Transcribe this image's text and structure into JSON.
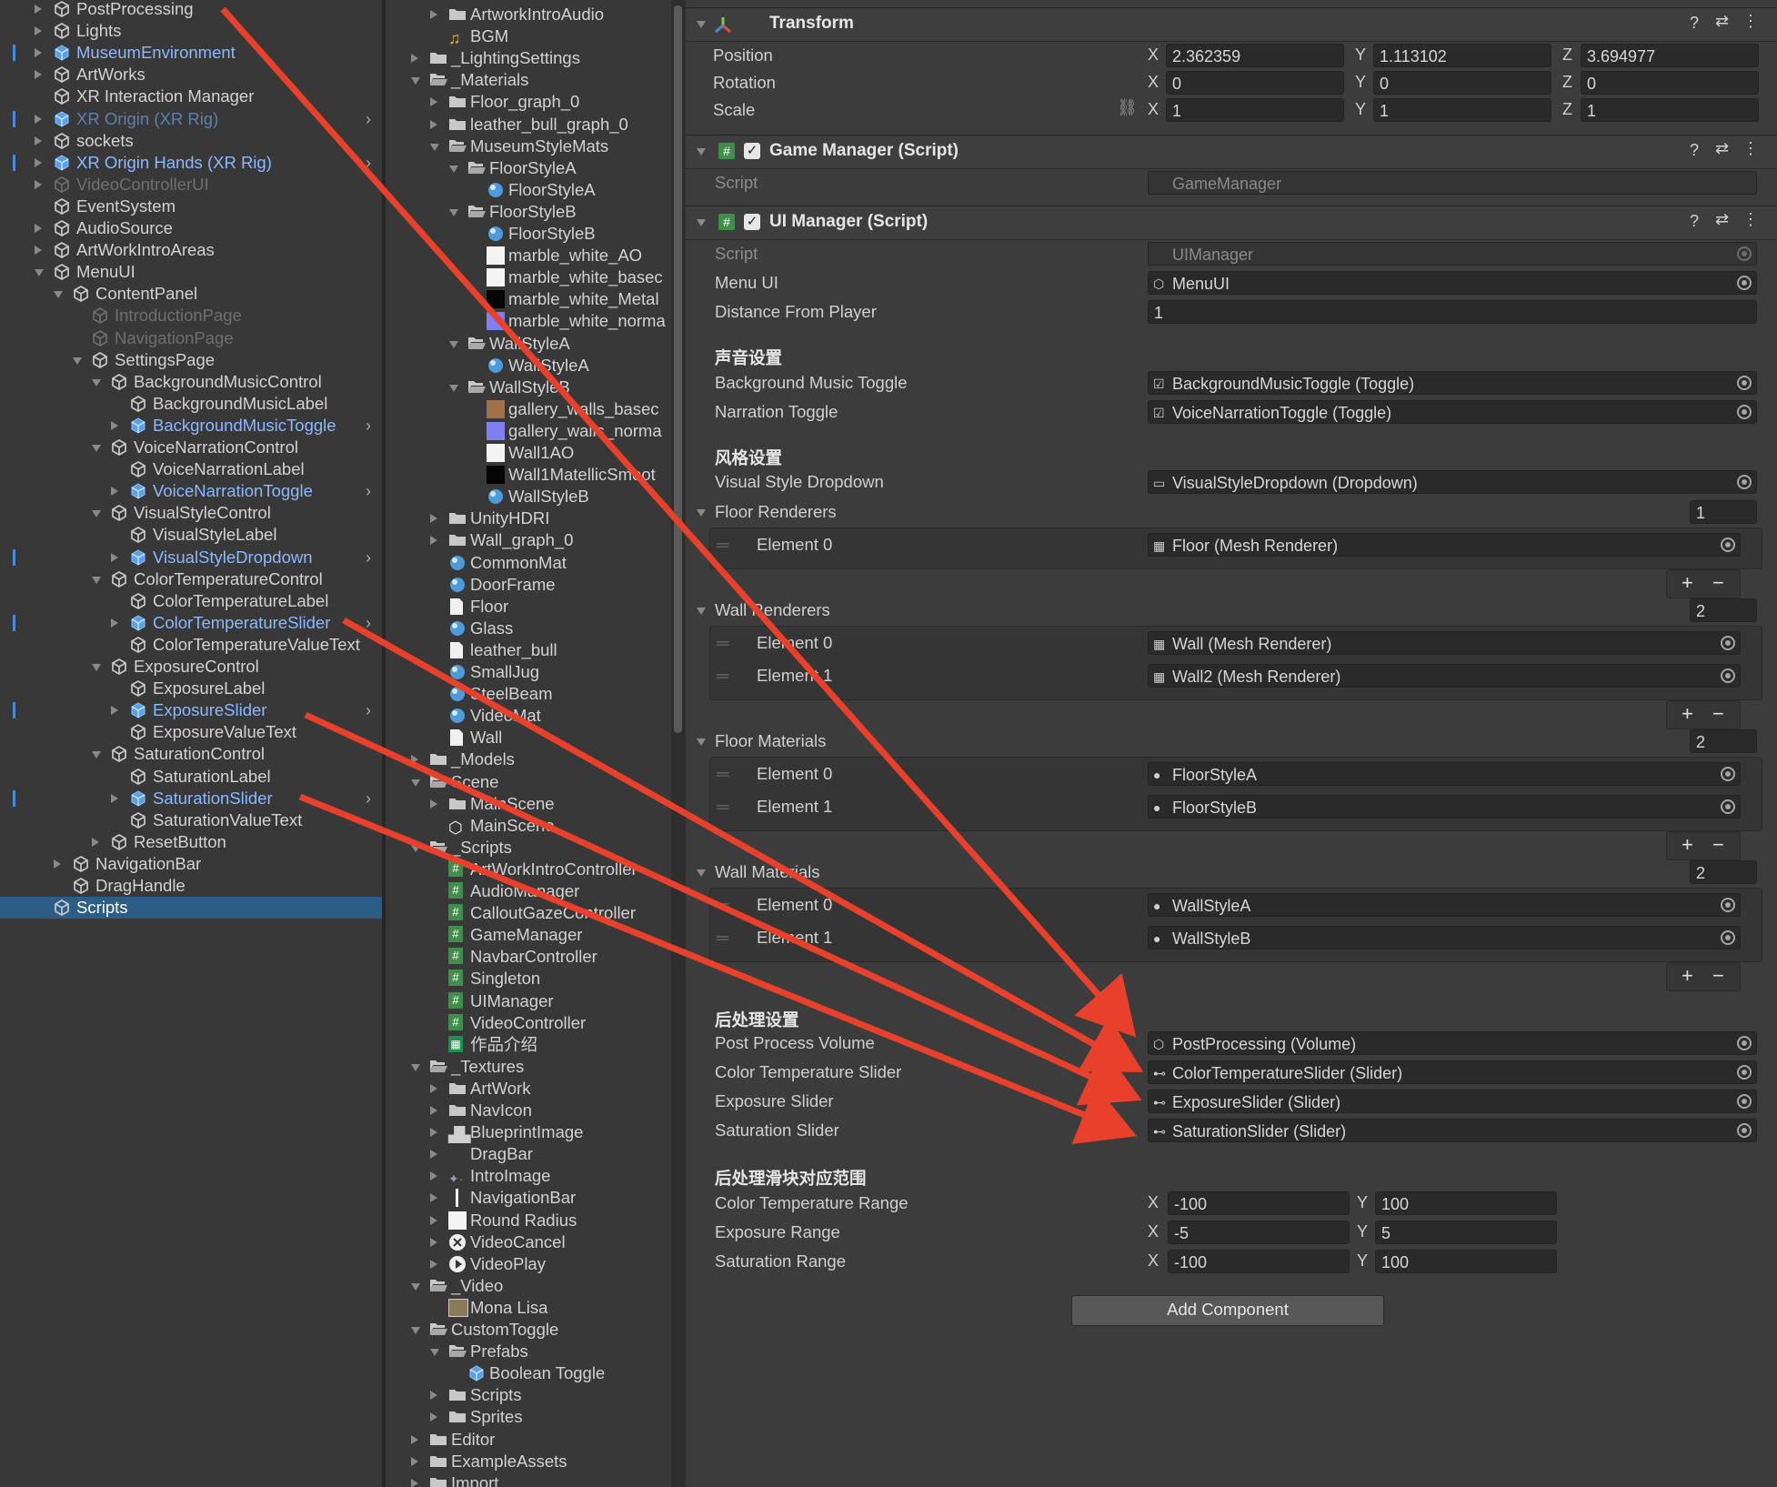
{
  "hierarchy": {
    "items": [
      {
        "label": "PostProcessing",
        "style": "normal",
        "indent": 0,
        "tri": "c",
        "icon": "cube-outline"
      },
      {
        "label": "Lights",
        "style": "normal",
        "indent": 0,
        "tri": "c",
        "icon": "cube-outline"
      },
      {
        "label": "MuseumEnvironment",
        "style": "blue",
        "indent": 0,
        "tri": "c",
        "icon": "prefab",
        "bar": true
      },
      {
        "label": "ArtWorks",
        "style": "normal",
        "indent": 0,
        "tri": "c",
        "icon": "cube-outline"
      },
      {
        "label": "XR Interaction Manager",
        "style": "normal",
        "indent": 0,
        "tri": "",
        "icon": "cube-outline"
      },
      {
        "label": "XR Origin (XR Rig)",
        "style": "blue-dim",
        "indent": 0,
        "tri": "c",
        "icon": "prefab",
        "bar": true,
        "chev": true
      },
      {
        "label": "sockets",
        "style": "normal",
        "indent": 0,
        "tri": "c",
        "icon": "cube-outline"
      },
      {
        "label": "XR Origin Hands (XR Rig)",
        "style": "blue",
        "indent": 0,
        "tri": "c",
        "icon": "prefab",
        "bar": true,
        "chev": true
      },
      {
        "label": "VideoControllerUI",
        "style": "dim",
        "indent": 0,
        "tri": "c",
        "icon": "cube-outline"
      },
      {
        "label": "EventSystem",
        "style": "normal",
        "indent": 0,
        "tri": "",
        "icon": "cube-outline"
      },
      {
        "label": "AudioSource",
        "style": "normal",
        "indent": 0,
        "tri": "c",
        "icon": "cube-outline"
      },
      {
        "label": "ArtWorkIntroAreas",
        "style": "normal",
        "indent": 0,
        "tri": "c",
        "icon": "cube-outline"
      },
      {
        "label": "MenuUI",
        "style": "normal",
        "indent": 0,
        "tri": "o",
        "icon": "cube-outline"
      },
      {
        "label": "ContentPanel",
        "style": "normal",
        "indent": 1,
        "tri": "o",
        "icon": "cube-outline"
      },
      {
        "label": "IntroductionPage",
        "style": "dim",
        "indent": 2,
        "tri": "",
        "icon": "cube-outline"
      },
      {
        "label": "NavigationPage",
        "style": "dim",
        "indent": 2,
        "tri": "",
        "icon": "cube-outline"
      },
      {
        "label": "SettingsPage",
        "style": "normal",
        "indent": 2,
        "tri": "o",
        "icon": "cube-outline"
      },
      {
        "label": "BackgroundMusicControl",
        "style": "normal",
        "indent": 3,
        "tri": "o",
        "icon": "cube-outline"
      },
      {
        "label": "BackgroundMusicLabel",
        "style": "normal",
        "indent": 4,
        "tri": "",
        "icon": "cube-outline"
      },
      {
        "label": "BackgroundMusicToggle",
        "style": "blue",
        "indent": 4,
        "tri": "c",
        "icon": "prefab",
        "chev": true
      },
      {
        "label": "VoiceNarrationControl",
        "style": "normal",
        "indent": 3,
        "tri": "o",
        "icon": "cube-outline"
      },
      {
        "label": "VoiceNarrationLabel",
        "style": "normal",
        "indent": 4,
        "tri": "",
        "icon": "cube-outline"
      },
      {
        "label": "VoiceNarrationToggle",
        "style": "blue",
        "indent": 4,
        "tri": "c",
        "icon": "prefab",
        "chev": true
      },
      {
        "label": "VisualStyleControl",
        "style": "normal",
        "indent": 3,
        "tri": "o",
        "icon": "cube-outline"
      },
      {
        "label": "VisualStyleLabel",
        "style": "normal",
        "indent": 4,
        "tri": "",
        "icon": "cube-outline"
      },
      {
        "label": "VisualStyleDropdown",
        "style": "blue",
        "indent": 4,
        "tri": "c",
        "icon": "prefab",
        "bar": true,
        "chev": true
      },
      {
        "label": "ColorTemperatureControl",
        "style": "normal",
        "indent": 3,
        "tri": "o",
        "icon": "cube-outline"
      },
      {
        "label": "ColorTemperatureLabel",
        "style": "normal",
        "indent": 4,
        "tri": "",
        "icon": "cube-outline"
      },
      {
        "label": "ColorTemperatureSlider",
        "style": "blue",
        "indent": 4,
        "tri": "c",
        "icon": "prefab",
        "bar": true,
        "chev": true
      },
      {
        "label": "ColorTemperatureValueText",
        "style": "normal",
        "indent": 4,
        "tri": "",
        "icon": "cube-outline"
      },
      {
        "label": "ExposureControl",
        "style": "normal",
        "indent": 3,
        "tri": "o",
        "icon": "cube-outline"
      },
      {
        "label": "ExposureLabel",
        "style": "normal",
        "indent": 4,
        "tri": "",
        "icon": "cube-outline"
      },
      {
        "label": "ExposureSlider",
        "style": "blue",
        "indent": 4,
        "tri": "c",
        "icon": "prefab",
        "bar": true,
        "chev": true
      },
      {
        "label": "ExposureValueText",
        "style": "normal",
        "indent": 4,
        "tri": "",
        "icon": "cube-outline"
      },
      {
        "label": "SaturationControl",
        "style": "normal",
        "indent": 3,
        "tri": "o",
        "icon": "cube-outline"
      },
      {
        "label": "SaturationLabel",
        "style": "normal",
        "indent": 4,
        "tri": "",
        "icon": "cube-outline"
      },
      {
        "label": "SaturationSlider",
        "style": "blue",
        "indent": 4,
        "tri": "c",
        "icon": "prefab",
        "bar": true,
        "chev": true
      },
      {
        "label": "SaturationValueText",
        "style": "normal",
        "indent": 4,
        "tri": "",
        "icon": "cube-outline"
      },
      {
        "label": "ResetButton",
        "style": "normal",
        "indent": 3,
        "tri": "c",
        "icon": "cube-outline"
      },
      {
        "label": "NavigationBar",
        "style": "normal",
        "indent": 1,
        "tri": "c",
        "icon": "cube-outline"
      },
      {
        "label": "DragHandle",
        "style": "normal",
        "indent": 1,
        "tri": "",
        "icon": "cube-outline"
      },
      {
        "label": "Scripts",
        "style": "selected",
        "indent": 0,
        "tri": "",
        "icon": "cube-outline"
      }
    ]
  },
  "project": {
    "items": [
      {
        "label": "ArtworkIntroAudio",
        "indent": 1,
        "tri": "c",
        "icon": "folder"
      },
      {
        "label": "BGM",
        "indent": 1,
        "tri": "",
        "icon": "audio"
      },
      {
        "label": "_LightingSettings",
        "indent": 0,
        "tri": "c",
        "icon": "folder"
      },
      {
        "label": "_Materials",
        "indent": 0,
        "tri": "o",
        "icon": "folder-open"
      },
      {
        "label": "Floor_graph_0",
        "indent": 1,
        "tri": "c",
        "icon": "folder"
      },
      {
        "label": "leather_bull_graph_0",
        "indent": 1,
        "tri": "c",
        "icon": "folder"
      },
      {
        "label": "MuseumStyleMats",
        "indent": 1,
        "tri": "o",
        "icon": "folder-open"
      },
      {
        "label": "FloorStyleA",
        "indent": 2,
        "tri": "o",
        "icon": "folder-open"
      },
      {
        "label": "FloorStyleA",
        "indent": 3,
        "tri": "",
        "icon": "material"
      },
      {
        "label": "FloorStyleB",
        "indent": 2,
        "tri": "o",
        "icon": "folder-open"
      },
      {
        "label": "FloorStyleB",
        "indent": 3,
        "tri": "",
        "icon": "material"
      },
      {
        "label": "marble_white_AO",
        "indent": 3,
        "tri": "",
        "icon": "tex-white"
      },
      {
        "label": "marble_white_basec",
        "indent": 3,
        "tri": "",
        "icon": "tex-white"
      },
      {
        "label": "marble_white_Metal",
        "indent": 3,
        "tri": "",
        "icon": "tex-black"
      },
      {
        "label": "marble_white_norma",
        "indent": 3,
        "tri": "",
        "icon": "tex-normal"
      },
      {
        "label": "WallStyleA",
        "indent": 2,
        "tri": "o",
        "icon": "folder-open"
      },
      {
        "label": "WallStyleA",
        "indent": 3,
        "tri": "",
        "icon": "material"
      },
      {
        "label": "WallStyleB",
        "indent": 2,
        "tri": "o",
        "icon": "folder-open"
      },
      {
        "label": "gallery_walls_basec",
        "indent": 3,
        "tri": "",
        "icon": "tex-brown"
      },
      {
        "label": "gallery_walls_norma",
        "indent": 3,
        "tri": "",
        "icon": "tex-normal"
      },
      {
        "label": "Wall1AO",
        "indent": 3,
        "tri": "",
        "icon": "tex-white"
      },
      {
        "label": "Wall1MatellicSmoot",
        "indent": 3,
        "tri": "",
        "icon": "tex-black"
      },
      {
        "label": "WallStyleB",
        "indent": 3,
        "tri": "",
        "icon": "material"
      },
      {
        "label": "UnityHDRI",
        "indent": 1,
        "tri": "c",
        "icon": "folder"
      },
      {
        "label": "Wall_graph_0",
        "indent": 1,
        "tri": "c",
        "icon": "folder"
      },
      {
        "label": "CommonMat",
        "indent": 1,
        "tri": "",
        "icon": "material"
      },
      {
        "label": "DoorFrame",
        "indent": 1,
        "tri": "",
        "icon": "material"
      },
      {
        "label": "Floor",
        "indent": 1,
        "tri": "",
        "icon": "file"
      },
      {
        "label": "Glass",
        "indent": 1,
        "tri": "",
        "icon": "material"
      },
      {
        "label": "leather_bull",
        "indent": 1,
        "tri": "",
        "icon": "file"
      },
      {
        "label": "SmallJug",
        "indent": 1,
        "tri": "",
        "icon": "material"
      },
      {
        "label": "SteelBeam",
        "indent": 1,
        "tri": "",
        "icon": "material"
      },
      {
        "label": "VideoMat",
        "indent": 1,
        "tri": "",
        "icon": "material"
      },
      {
        "label": "Wall",
        "indent": 1,
        "tri": "",
        "icon": "file"
      },
      {
        "label": "_Models",
        "indent": 0,
        "tri": "c",
        "icon": "folder"
      },
      {
        "label": "Scene",
        "indent": 0,
        "tri": "o",
        "icon": "folder-open"
      },
      {
        "label": "MainScene",
        "indent": 1,
        "tri": "c",
        "icon": "folder"
      },
      {
        "label": "MainScene",
        "indent": 1,
        "tri": "",
        "icon": "unity"
      },
      {
        "label": "_Scripts",
        "indent": 0,
        "tri": "o",
        "icon": "folder-open"
      },
      {
        "label": "ArtWorkIntroController",
        "indent": 1,
        "tri": "",
        "icon": "script"
      },
      {
        "label": "AudioManager",
        "indent": 1,
        "tri": "",
        "icon": "script"
      },
      {
        "label": "CalloutGazeController",
        "indent": 1,
        "tri": "",
        "icon": "script"
      },
      {
        "label": "GameManager",
        "indent": 1,
        "tri": "",
        "icon": "script"
      },
      {
        "label": "NavbarController",
        "indent": 1,
        "tri": "",
        "icon": "script"
      },
      {
        "label": "Singleton",
        "indent": 1,
        "tri": "",
        "icon": "script"
      },
      {
        "label": "UIManager",
        "indent": 1,
        "tri": "",
        "icon": "script"
      },
      {
        "label": "VideoController",
        "indent": 1,
        "tri": "",
        "icon": "script"
      },
      {
        "label": "作品介绍",
        "indent": 1,
        "tri": "",
        "icon": "sheet"
      },
      {
        "label": "_Textures",
        "indent": 0,
        "tri": "o",
        "icon": "folder-open"
      },
      {
        "label": "ArtWork",
        "indent": 1,
        "tri": "c",
        "icon": "folder"
      },
      {
        "label": "NavIcon",
        "indent": 1,
        "tri": "c",
        "icon": "folder"
      },
      {
        "label": "BlueprintImage",
        "indent": 1,
        "tri": "c",
        "icon": "image"
      },
      {
        "label": "DragBar",
        "indent": 1,
        "tri": "c",
        "icon": "none"
      },
      {
        "label": "IntroImage",
        "indent": 1,
        "tri": "c",
        "icon": "image-dark"
      },
      {
        "label": "NavigationBar",
        "indent": 1,
        "tri": "c",
        "icon": "bar"
      },
      {
        "label": "Round Radius",
        "indent": 1,
        "tri": "c",
        "icon": "tex-white"
      },
      {
        "label": "VideoCancel",
        "indent": 1,
        "tri": "c",
        "icon": "cancel"
      },
      {
        "label": "VideoPlay",
        "indent": 1,
        "tri": "c",
        "icon": "play"
      },
      {
        "label": "_Video",
        "indent": 0,
        "tri": "o",
        "icon": "folder-open"
      },
      {
        "label": "Mona Lisa",
        "indent": 1,
        "tri": "",
        "icon": "video"
      },
      {
        "label": "CustomToggle",
        "indent": 0,
        "tri": "o",
        "icon": "folder-open"
      },
      {
        "label": "Prefabs",
        "indent": 1,
        "tri": "o",
        "icon": "folder-open"
      },
      {
        "label": "Boolean Toggle",
        "indent": 2,
        "tri": "",
        "icon": "prefab"
      },
      {
        "label": "Scripts",
        "indent": 1,
        "tri": "c",
        "icon": "folder"
      },
      {
        "label": "Sprites",
        "indent": 1,
        "tri": "c",
        "icon": "folder"
      },
      {
        "label": "Editor",
        "indent": 0,
        "tri": "c",
        "icon": "folder"
      },
      {
        "label": "ExampleAssets",
        "indent": 0,
        "tri": "c",
        "icon": "folder"
      },
      {
        "label": "Import",
        "indent": 0,
        "tri": "c",
        "icon": "folder"
      }
    ]
  },
  "inspector": {
    "transform": {
      "title": "Transform",
      "position_label": "Position",
      "rotation_label": "Rotation",
      "scale_label": "Scale",
      "position": {
        "x": "2.362359",
        "y": "1.113102",
        "z": "3.694977"
      },
      "rotation": {
        "x": "0",
        "y": "0",
        "z": "0"
      },
      "scale": {
        "x": "1",
        "y": "1",
        "z": "1"
      }
    },
    "axis": {
      "x": "X",
      "y": "Y",
      "z": "Z"
    },
    "game_manager": {
      "title": "Game Manager (Script)",
      "script_label": "Script",
      "script_value": "GameManager"
    },
    "ui_manager": {
      "title": "UI Manager (Script)",
      "script_label": "Script",
      "script_value": "UIManager",
      "menu_ui_label": "Menu UI",
      "menu_ui_value": "MenuUI",
      "distance_label": "Distance From Player",
      "distance_value": "1",
      "sound_header": "声音设置",
      "bgm_toggle_label": "Background Music Toggle",
      "bgm_toggle_value": "BackgroundMusicToggle (Toggle)",
      "narration_label": "Narration Toggle",
      "narration_value": "VoiceNarrationToggle (Toggle)",
      "style_header": "风格设置",
      "dropdown_label": "Visual Style Dropdown",
      "dropdown_value": "VisualStyleDropdown (Dropdown)",
      "floor_renderers": {
        "label": "Floor Renderers",
        "count": "1",
        "elements": [
          {
            "label": "Element 0",
            "value": "Floor (Mesh Renderer)"
          }
        ]
      },
      "wall_renderers": {
        "label": "Wall Renderers",
        "count": "2",
        "elements": [
          {
            "label": "Element 0",
            "value": "Wall (Mesh Renderer)"
          },
          {
            "label": "Element 1",
            "value": "Wall2 (Mesh Renderer)"
          }
        ]
      },
      "floor_materials": {
        "label": "Floor Materials",
        "count": "2",
        "elements": [
          {
            "label": "Element 0",
            "value": "FloorStyleA"
          },
          {
            "label": "Element 1",
            "value": "FloorStyleB"
          }
        ]
      },
      "wall_materials": {
        "label": "Wall Materials",
        "count": "2",
        "elements": [
          {
            "label": "Element 0",
            "value": "WallStyleA"
          },
          {
            "label": "Element 1",
            "value": "WallStyleB"
          }
        ]
      },
      "post_header": "后处理设置",
      "ppv_label": "Post Process Volume",
      "ppv_value": "PostProcessing (Volume)",
      "cts_label": "Color Temperature Slider",
      "cts_value": "ColorTemperatureSlider (Slider)",
      "exs_label": "Exposure Slider",
      "exs_value": "ExposureSlider (Slider)",
      "sat_label": "Saturation Slider",
      "sat_value": "SaturationSlider (Slider)",
      "range_header": "后处理滑块对应范围",
      "ct_range_label": "Color Temperature Range",
      "ct_range": {
        "x": "-100",
        "y": "100"
      },
      "ex_range_label": "Exposure Range",
      "ex_range": {
        "x": "-5",
        "y": "5"
      },
      "sat_range_label": "Saturation Range",
      "sat_range": {
        "x": "-100",
        "y": "100"
      }
    },
    "plus": "+",
    "minus": "−",
    "add_component": "Add Component"
  },
  "colors": {
    "arrow": "#e8402a",
    "selection": "#2c5d87",
    "prefab_blue": "#8bb8ff",
    "script_green": "#3f8e4a"
  }
}
